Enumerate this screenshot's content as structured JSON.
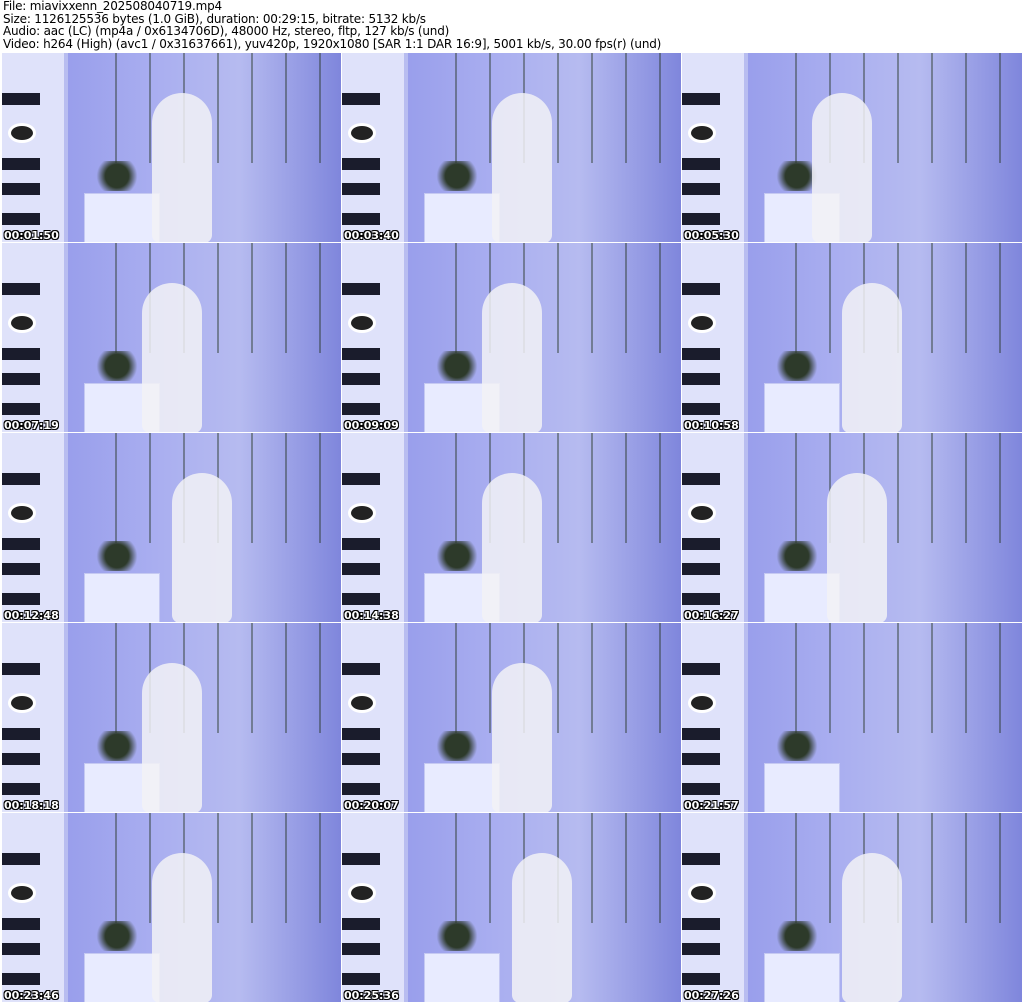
{
  "header": {
    "file": "File: miavixxenn_202508040719.mp4",
    "size": "Size: 1126125536 bytes (1.0 GiB), duration: 00:29:15, bitrate: 5132 kb/s",
    "audio": "Audio: aac (LC) (mp4a / 0x6134706D), 48000 Hz, stereo, fltp, 127 kb/s (und)",
    "video": "Video: h264 (High) (avc1 / 0x31637661), yuv420p, 1920x1080 [SAR 1:1 DAR 16:9], 5001 kb/s, 30.00 fps(r) (und)"
  },
  "thumbnails": [
    "00:01:50",
    "00:03:40",
    "00:05:30",
    "00:07:19",
    "00:09:09",
    "00:10:58",
    "00:12:48",
    "00:14:38",
    "00:16:27",
    "00:18:18",
    "00:20:07",
    "00:21:57",
    "00:23:46",
    "00:25:36",
    "00:27:26"
  ]
}
